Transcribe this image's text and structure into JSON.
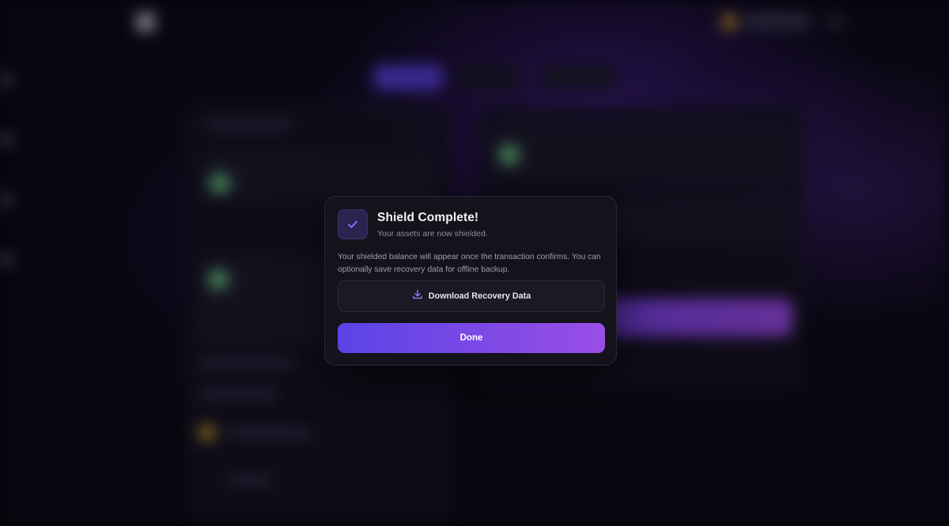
{
  "modal": {
    "title": "Shield Complete!",
    "subtitle": "Your assets are now shielded.",
    "body": "Your shielded balance will appear once the transaction confirms. You can optionally save recovery data for offline backup.",
    "download_label": "Download Recovery Data",
    "done_label": "Done",
    "icon": "checkmark-icon",
    "download_icon": "download-icon"
  },
  "colors": {
    "accent": "#7b5cf0",
    "done_gradient_start": "#5a43e6",
    "done_gradient_end": "#9a4ee6",
    "modal_background": "#14131c"
  }
}
